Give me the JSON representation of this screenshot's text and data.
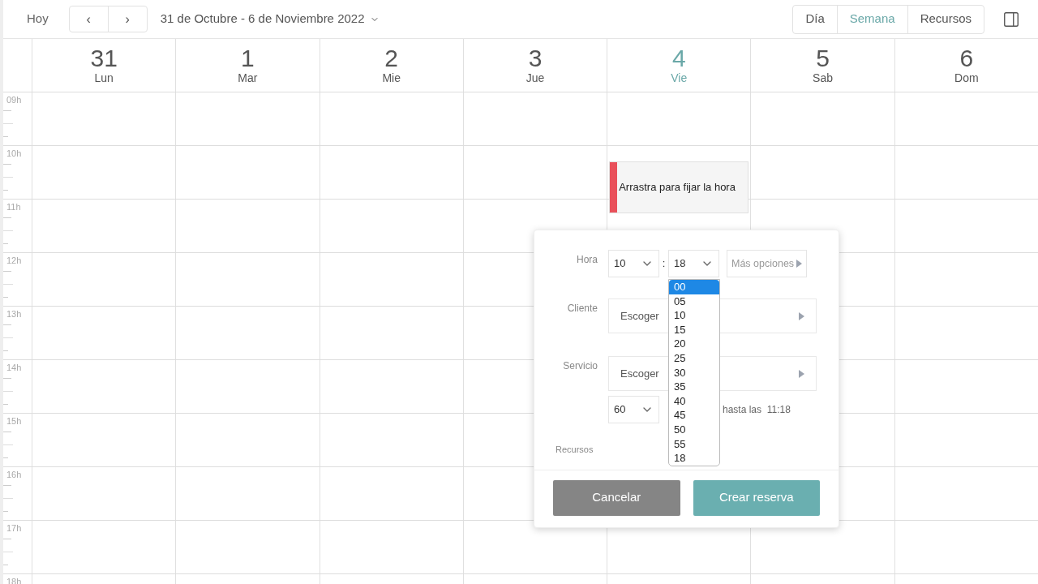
{
  "toolbar": {
    "today": "Hoy",
    "prev": "‹",
    "next": "›",
    "range": "31 de Octubre - 6 de Noviembre 2022",
    "views": [
      {
        "label": "Día",
        "selected": false
      },
      {
        "label": "Semana",
        "selected": true
      },
      {
        "label": "Recursos",
        "selected": false
      }
    ]
  },
  "days": [
    {
      "number": "31",
      "weekday": "Lun",
      "selected": false
    },
    {
      "number": "1",
      "weekday": "Mar",
      "selected": false
    },
    {
      "number": "2",
      "weekday": "Mie",
      "selected": false
    },
    {
      "number": "3",
      "weekday": "Jue",
      "selected": false
    },
    {
      "number": "4",
      "weekday": "Vie",
      "selected": true
    },
    {
      "number": "5",
      "weekday": "Sab",
      "selected": false
    },
    {
      "number": "6",
      "weekday": "Dom",
      "selected": false
    }
  ],
  "hours": [
    "09h",
    "10h",
    "11h",
    "12h",
    "13h",
    "14h",
    "15h",
    "16h",
    "17h",
    "18h"
  ],
  "event": {
    "text": "Arrastra para fijar la hora",
    "color": "#e9505a"
  },
  "popup": {
    "hora_label": "Hora",
    "hour": "10",
    "separator": ":",
    "minute": "18",
    "more": "Más opciones",
    "minute_options": [
      {
        "label": "00",
        "selected": true
      },
      {
        "label": "05",
        "selected": false
      },
      {
        "label": "10",
        "selected": false
      },
      {
        "label": "15",
        "selected": false
      },
      {
        "label": "20",
        "selected": false
      },
      {
        "label": "25",
        "selected": false
      },
      {
        "label": "30",
        "selected": false
      },
      {
        "label": "35",
        "selected": false
      },
      {
        "label": "40",
        "selected": false
      },
      {
        "label": "45",
        "selected": false
      },
      {
        "label": "50",
        "selected": false
      },
      {
        "label": "55",
        "selected": false
      },
      {
        "label": "18",
        "selected": false
      }
    ],
    "cliente_label": "Cliente",
    "cliente_value": "Escoger",
    "servicio_label": "Servicio",
    "servicio_value": "Escoger",
    "duration": "60",
    "until": "hasta las  11:18",
    "recursos_label": "Recursos",
    "cancel": "Cancelar",
    "create": "Crear reserva"
  }
}
